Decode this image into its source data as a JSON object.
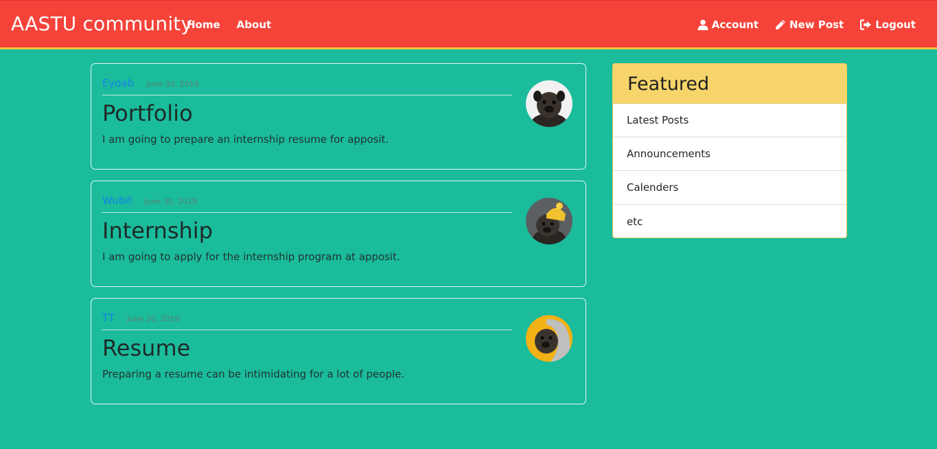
{
  "brand": "AASTU community",
  "nav": {
    "home": "Home",
    "about": "About",
    "account": "Account",
    "new_post": "New Post",
    "logout": "Logout"
  },
  "posts": [
    {
      "author": "Eyoab",
      "date": "June 30, 2019",
      "title": "Portfolio",
      "body": "I am going to prepare an internship resume for apposit.",
      "avatar": "dog-avatar-white"
    },
    {
      "author": "Wubit",
      "date": "June 30, 2019",
      "title": "Internship",
      "body": "I am going to apply for the internship program at apposit.",
      "avatar": "dog-avatar-yellow-hat"
    },
    {
      "author": "TT",
      "date": "June 30, 2019",
      "title": "Resume",
      "body": "Preparing a resume can be intimidating for a lot of people.",
      "avatar": "dog-avatar-hoodie"
    }
  ],
  "featured": {
    "title": "Featured",
    "items": [
      "Latest Posts",
      "Announcements",
      "Calenders",
      "etc"
    ]
  },
  "colors": {
    "navbar": "#f5433a",
    "background": "#1abc9c",
    "accent_border": "#f7c544",
    "featured_header": "#f7d56a",
    "author_link": "#1583e8"
  }
}
